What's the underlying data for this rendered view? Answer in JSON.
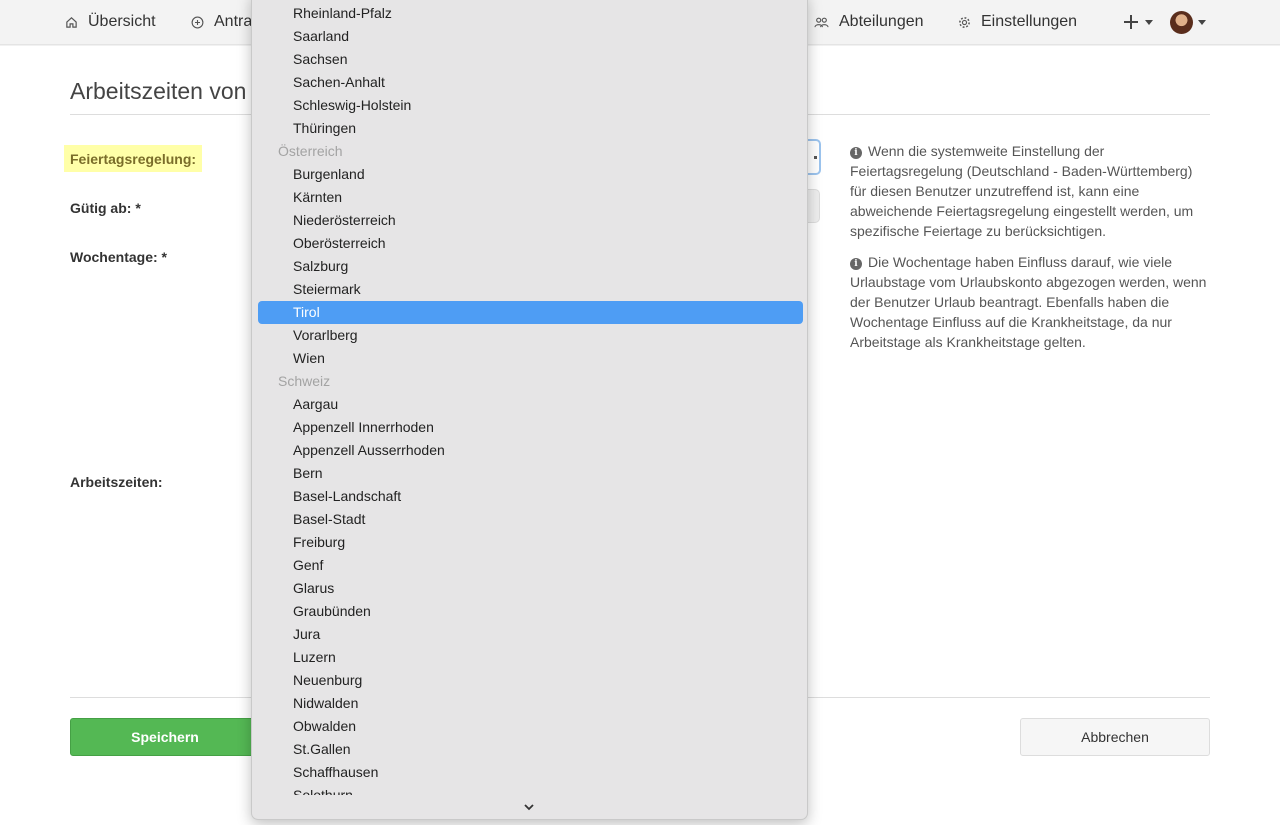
{
  "nav": {
    "home": "Übersicht",
    "antrag": "Antra",
    "abteilungen": "Abteilungen",
    "einstellungen": "Einstellungen"
  },
  "page": {
    "title": "Arbeitszeiten von",
    "labels": {
      "feiertag": "Feiertagsregelung:",
      "gueltig": "Gütig ab: *",
      "wochentage": "Wochentage: *",
      "arbeitszeiten": "Arbeitszeiten:"
    },
    "help1": "Wenn die systemweite Einstellung der Feiertagsregelung (Deutschland - Baden-Württemberg) für diesen Benutzer unzutreffend ist, kann eine abweichende Feiertagsregelung eingestellt werden, um spezifische Feiertage zu berücksichtigen.",
    "help2": "Die Wochentage haben Einfluss darauf, wie viele Urlaubstage vom Urlaubskonto abgezogen werden, wenn der Benutzer Urlaub beantragt. Ebenfalls haben die Wochentage Einfluss auf die Krankheitstage, da nur Arbeitstage als Krankheitstage gelten.",
    "save": "Speichern",
    "cancel": "Abbrechen"
  },
  "dropdown": {
    "selected": "Tirol",
    "items": [
      {
        "label": "Rheinland-Pfalz",
        "group": false
      },
      {
        "label": "Saarland",
        "group": false
      },
      {
        "label": "Sachsen",
        "group": false
      },
      {
        "label": "Sachen-Anhalt",
        "group": false
      },
      {
        "label": "Schleswig-Holstein",
        "group": false
      },
      {
        "label": "Thüringen",
        "group": false
      },
      {
        "label": "Österreich",
        "group": true
      },
      {
        "label": "Burgenland",
        "group": false
      },
      {
        "label": "Kärnten",
        "group": false
      },
      {
        "label": "Niederösterreich",
        "group": false
      },
      {
        "label": "Oberösterreich",
        "group": false
      },
      {
        "label": "Salzburg",
        "group": false
      },
      {
        "label": "Steiermark",
        "group": false
      },
      {
        "label": "Tirol",
        "group": false
      },
      {
        "label": "Vorarlberg",
        "group": false
      },
      {
        "label": "Wien",
        "group": false
      },
      {
        "label": "Schweiz",
        "group": true
      },
      {
        "label": "Aargau",
        "group": false
      },
      {
        "label": "Appenzell Innerrhoden",
        "group": false
      },
      {
        "label": "Appenzell Ausserrhoden",
        "group": false
      },
      {
        "label": "Bern",
        "group": false
      },
      {
        "label": "Basel-Landschaft",
        "group": false
      },
      {
        "label": "Basel-Stadt",
        "group": false
      },
      {
        "label": "Freiburg",
        "group": false
      },
      {
        "label": "Genf",
        "group": false
      },
      {
        "label": "Glarus",
        "group": false
      },
      {
        "label": "Graubünden",
        "group": false
      },
      {
        "label": "Jura",
        "group": false
      },
      {
        "label": "Luzern",
        "group": false
      },
      {
        "label": "Neuenburg",
        "group": false
      },
      {
        "label": "Nidwalden",
        "group": false
      },
      {
        "label": "Obwalden",
        "group": false
      },
      {
        "label": "St.Gallen",
        "group": false
      },
      {
        "label": "Schaffhausen",
        "group": false
      },
      {
        "label": "Solothurn",
        "group": false
      }
    ]
  }
}
